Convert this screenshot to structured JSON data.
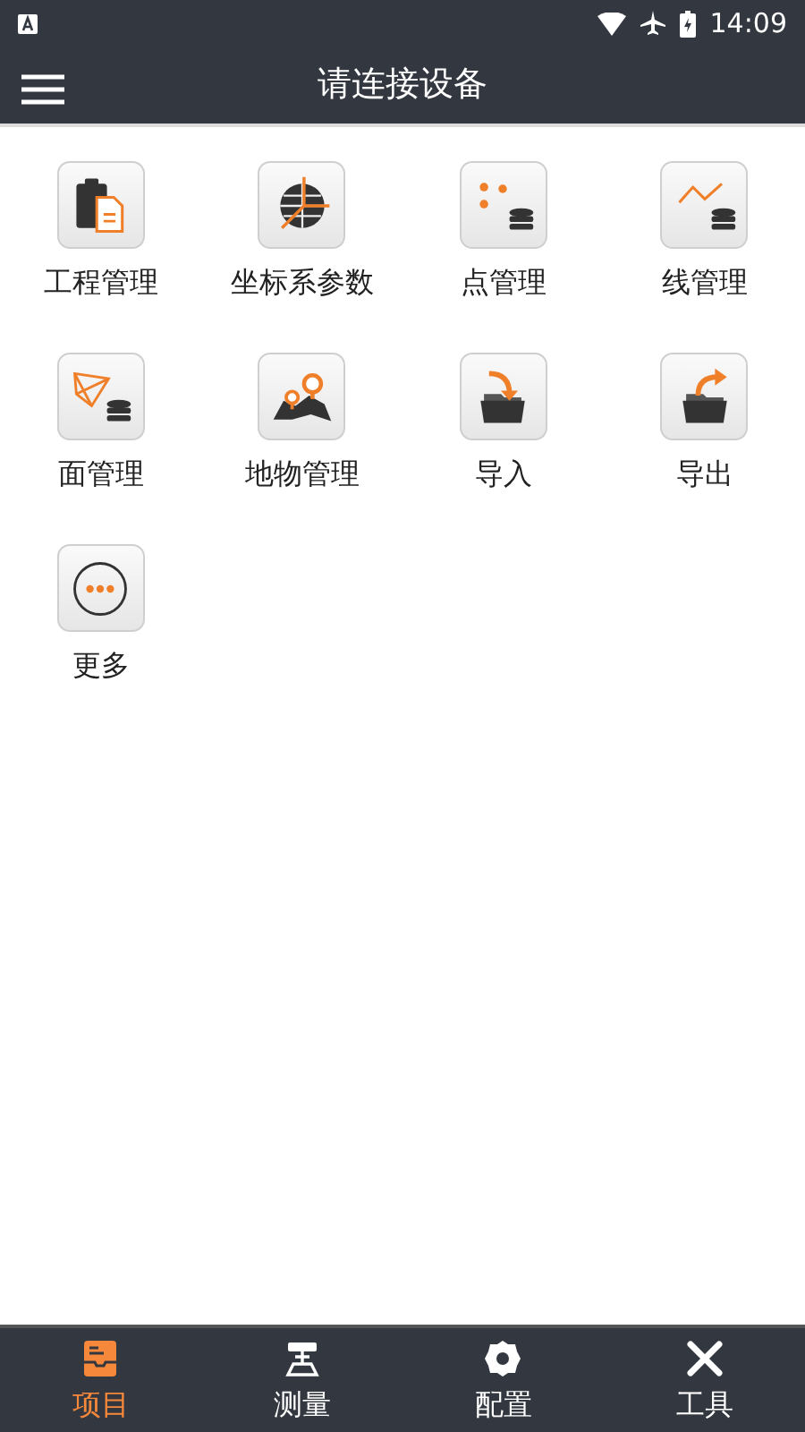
{
  "status_bar": {
    "time": "14:09"
  },
  "app_bar": {
    "title": "请连接设备"
  },
  "tiles": [
    {
      "label": "工程管理"
    },
    {
      "label": "坐标系参数"
    },
    {
      "label": "点管理"
    },
    {
      "label": "线管理"
    },
    {
      "label": "面管理"
    },
    {
      "label": "地物管理"
    },
    {
      "label": "导入"
    },
    {
      "label": "导出"
    },
    {
      "label": "更多"
    }
  ],
  "bottom_nav": [
    {
      "label": "项目",
      "selected": true
    },
    {
      "label": "测量",
      "selected": false
    },
    {
      "label": "配置",
      "selected": false
    },
    {
      "label": "工具",
      "selected": false
    }
  ]
}
